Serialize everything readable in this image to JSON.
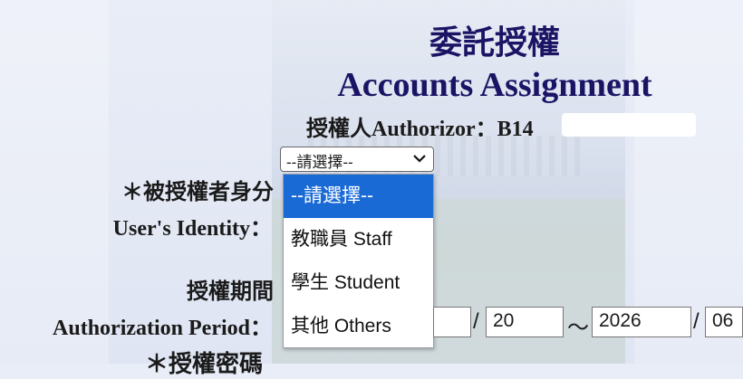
{
  "title": {
    "chinese": "委託授權",
    "english": "Accounts Assignment"
  },
  "authorizor": {
    "label_cn": "授權人",
    "label_en": "Authorizor：",
    "value": "B14"
  },
  "identity": {
    "label_cn": "＊被授權者身分",
    "label_en": "User's Identity：",
    "selected": "--請選擇--",
    "options": [
      "--請選擇--",
      "教職員 Staff",
      "學生 Student",
      "其他 Others"
    ]
  },
  "period": {
    "label_cn": "授權期間",
    "label_en": "Authorization Period：",
    "start_day": "20",
    "end_year": "2026",
    "end_month": "06",
    "slash": "/",
    "tilde": "～"
  },
  "password_label_cn": "＊授權密碼",
  "colors": {
    "title": "#1b1465",
    "selected_option": "#1a6ad6"
  },
  "icons": {
    "select_chevron": "chevron-down-icon"
  }
}
